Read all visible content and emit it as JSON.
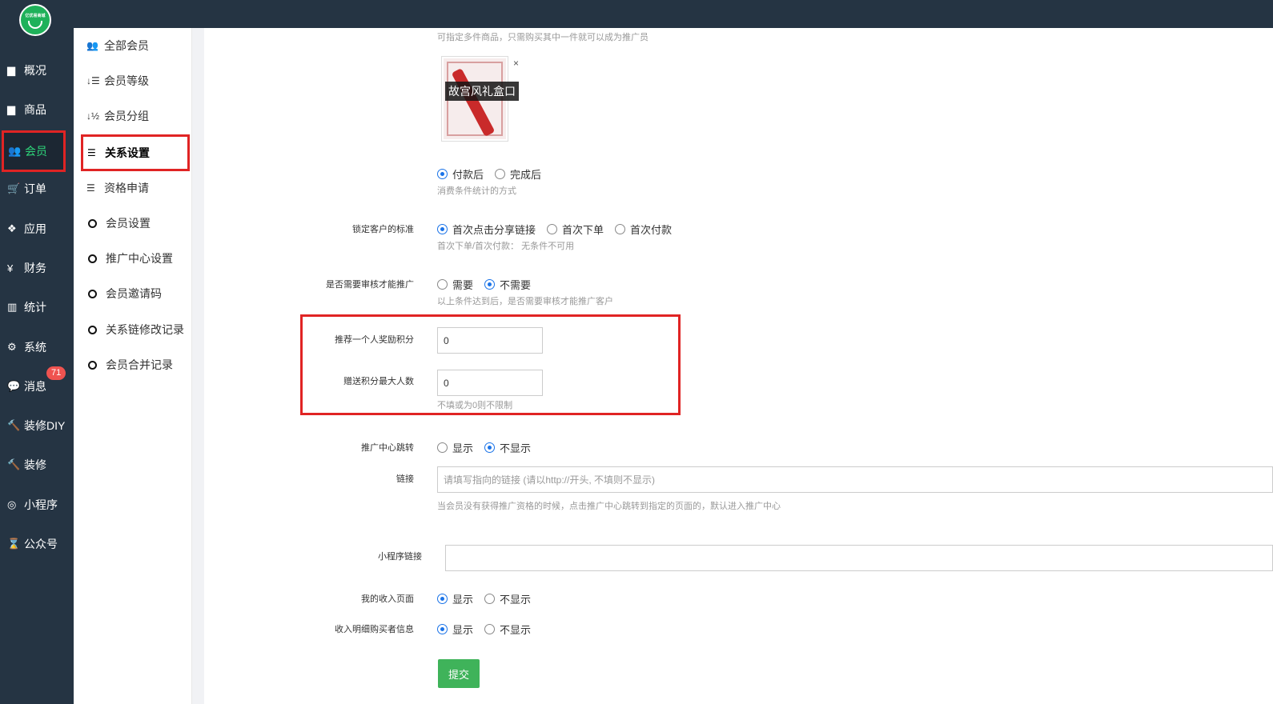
{
  "logo": {
    "text": "亿优易商城"
  },
  "nav": [
    {
      "label": "概况",
      "icon": "archive-icon"
    },
    {
      "label": "商品",
      "icon": "box-icon"
    },
    {
      "label": "会员",
      "icon": "users-icon"
    },
    {
      "label": "订单",
      "icon": "cart-icon"
    },
    {
      "label": "应用",
      "icon": "cubes-icon"
    },
    {
      "label": "财务",
      "icon": "yen-icon"
    },
    {
      "label": "统计",
      "icon": "bar-chart-icon"
    },
    {
      "label": "系统",
      "icon": "gears-icon"
    },
    {
      "label": "消息",
      "icon": "comment-icon"
    },
    {
      "label": "装修DIY",
      "icon": "gavel-icon"
    },
    {
      "label": "装修",
      "icon": "gavel-icon"
    },
    {
      "label": "小程序",
      "icon": "wechat-icon"
    },
    {
      "label": "公众号",
      "icon": "hourglass-icon"
    }
  ],
  "message_badge": "71",
  "subnav": [
    {
      "label": "全部会员",
      "icon": "users-icon"
    },
    {
      "label": "会员等级",
      "icon": "sort-amount-icon"
    },
    {
      "label": "会员分组",
      "icon": "sort-numeric-icon"
    },
    {
      "label": "关系设置",
      "icon": "sliders-icon"
    },
    {
      "label": "资格申请",
      "icon": "sliders-icon"
    },
    {
      "label": "会员设置",
      "icon": "circle-icon"
    },
    {
      "label": "推广中心设置",
      "icon": "circle-icon"
    },
    {
      "label": "会员邀请码",
      "icon": "circle-icon"
    },
    {
      "label": "关系链修改记录",
      "icon": "circle-icon"
    },
    {
      "label": "会员合并记录",
      "icon": "circle-icon"
    }
  ],
  "form": {
    "goods_hint": "可指定多件商品，只需购买其中一件就可以成为推广员",
    "goods_caption": "故宫风礼盒口",
    "goods_close": "×",
    "consume": {
      "options": [
        "付款后",
        "完成后"
      ],
      "selected": 0,
      "hint": "消费条件统计的方式"
    },
    "lock": {
      "label": "锁定客户的标准",
      "options": [
        "首次点击分享链接",
        "首次下单",
        "首次付款"
      ],
      "selected": 0,
      "hint": "首次下单/首次付款： 无条件不可用"
    },
    "audit": {
      "label": "是否需要审核才能推广",
      "options": [
        "需要",
        "不需要"
      ],
      "selected": 1,
      "hint": "以上条件达到后，是否需要审核才能推广客户"
    },
    "reward": {
      "label": "推荐一个人奖励积分",
      "value": "0"
    },
    "max_people": {
      "label": "赠送积分最大人数",
      "value": "0",
      "hint": "不填或为0则不限制"
    },
    "center_jump": {
      "label": "推广中心跳转",
      "options": [
        "显示",
        "不显示"
      ],
      "selected": 1
    },
    "link": {
      "label": "链接",
      "placeholder": "请填写指向的链接 (请以http://开头, 不填则不显示)",
      "hint": "当会员没有获得推广资格的时候，点击推广中心跳转到指定的页面的，默认进入推广中心"
    },
    "mini_link": {
      "label": "小程序链接",
      "value": ""
    },
    "income_page": {
      "label": "我的收入页面",
      "options": [
        "显示",
        "不显示"
      ],
      "selected": 0
    },
    "buyer_info": {
      "label": "收入明细购买者信息",
      "options": [
        "显示",
        "不显示"
      ],
      "selected": 0
    },
    "submit": "提交"
  }
}
